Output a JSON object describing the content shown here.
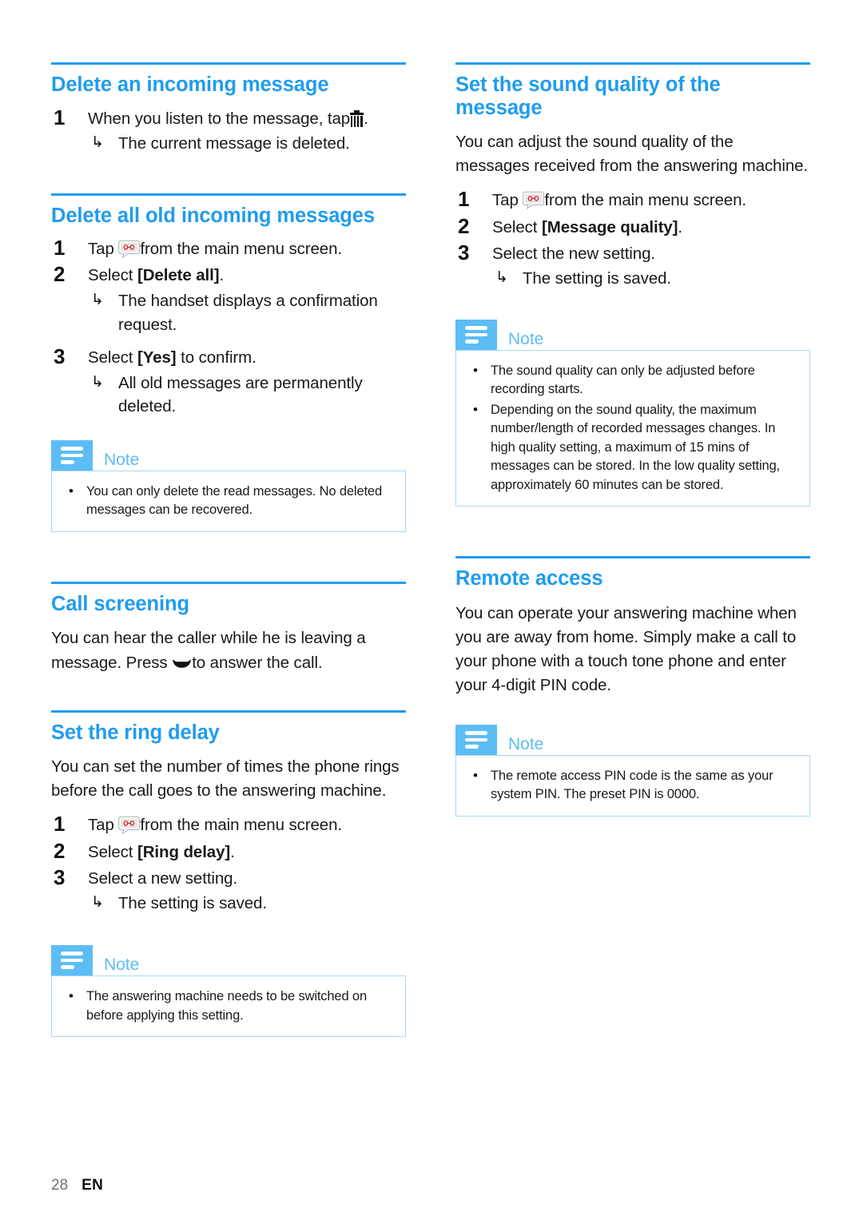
{
  "page": {
    "number": "28",
    "language": "EN"
  },
  "colors": {
    "heading_blue": "#1f9cf0",
    "note_blue": "#5cbdf4",
    "note_border": "#a8d9f5"
  },
  "note_label": "Note",
  "left_column": {
    "sections": [
      {
        "heading": "Delete an incoming message",
        "steps": [
          {
            "number": "1",
            "text_before": "When you listen to the message, tap",
            "icon": "trash-icon",
            "text_after": ".",
            "results": [
              "The current message is deleted."
            ]
          }
        ]
      },
      {
        "heading": "Delete all old incoming messages",
        "steps": [
          {
            "number": "1",
            "text_before": "Tap",
            "icon": "answering-machine-icon",
            "text_after": "from the main menu screen.",
            "results": []
          },
          {
            "number": "2",
            "text_before": "Select",
            "bold": "[Delete all]",
            "text_after": ".",
            "results": [
              "The handset displays a confirmation request."
            ]
          },
          {
            "number": "3",
            "text_before": "Select",
            "bold": "[Yes]",
            "text_after": "to confirm.",
            "results": [
              "All old messages are permanently deleted."
            ]
          }
        ],
        "note": {
          "items": [
            "You can only delete the read messages. No deleted messages can be recovered."
          ]
        }
      },
      {
        "heading": "Call screening",
        "paragraph_before": "You can hear the caller while he is leaving a message. Press",
        "inline_icon": "talk-key-icon",
        "paragraph_after": "to answer the call."
      },
      {
        "heading": "Set the ring delay",
        "paragraph": "You can set the number of times the phone rings before the call goes to the answering machine.",
        "steps": [
          {
            "number": "1",
            "text_before": "Tap",
            "icon": "answering-machine-icon",
            "text_after": "from the main menu screen.",
            "results": []
          },
          {
            "number": "2",
            "text_before": "Select",
            "bold": "[Ring delay]",
            "text_after": ".",
            "results": []
          },
          {
            "number": "3",
            "text_before": "Select a new setting.",
            "results": [
              "The setting is saved."
            ]
          }
        ],
        "note": {
          "items": [
            "The answering machine needs to be switched on before applying this setting."
          ]
        }
      }
    ]
  },
  "right_column": {
    "sections": [
      {
        "heading": "Set the sound quality of the message",
        "paragraph": "You can adjust the sound quality of the messages received from the answering machine.",
        "steps": [
          {
            "number": "1",
            "text_before": "Tap",
            "icon": "answering-machine-icon",
            "text_after": "from the main menu screen.",
            "results": []
          },
          {
            "number": "2",
            "text_before": "Select",
            "bold": "[Message quality]",
            "text_after": ".",
            "results": []
          },
          {
            "number": "3",
            "text_before": "Select the new setting.",
            "results": [
              "The setting is saved."
            ]
          }
        ],
        "note": {
          "items": [
            "The sound quality can only be adjusted before recording starts.",
            "Depending on the sound quality, the maximum number/length of recorded messages changes. In high quality setting, a maximum of 15 mins of messages can be stored. In the low quality setting, approximately 60 minutes can be stored."
          ]
        }
      },
      {
        "heading": "Remote access",
        "paragraph": "You can operate your answering machine when you are away from home. Simply make a call to your phone with a touch tone phone and enter your 4-digit PIN code.",
        "note": {
          "items": [
            "The remote access PIN code is the same as your system PIN. The preset PIN is 0000."
          ]
        }
      }
    ]
  }
}
